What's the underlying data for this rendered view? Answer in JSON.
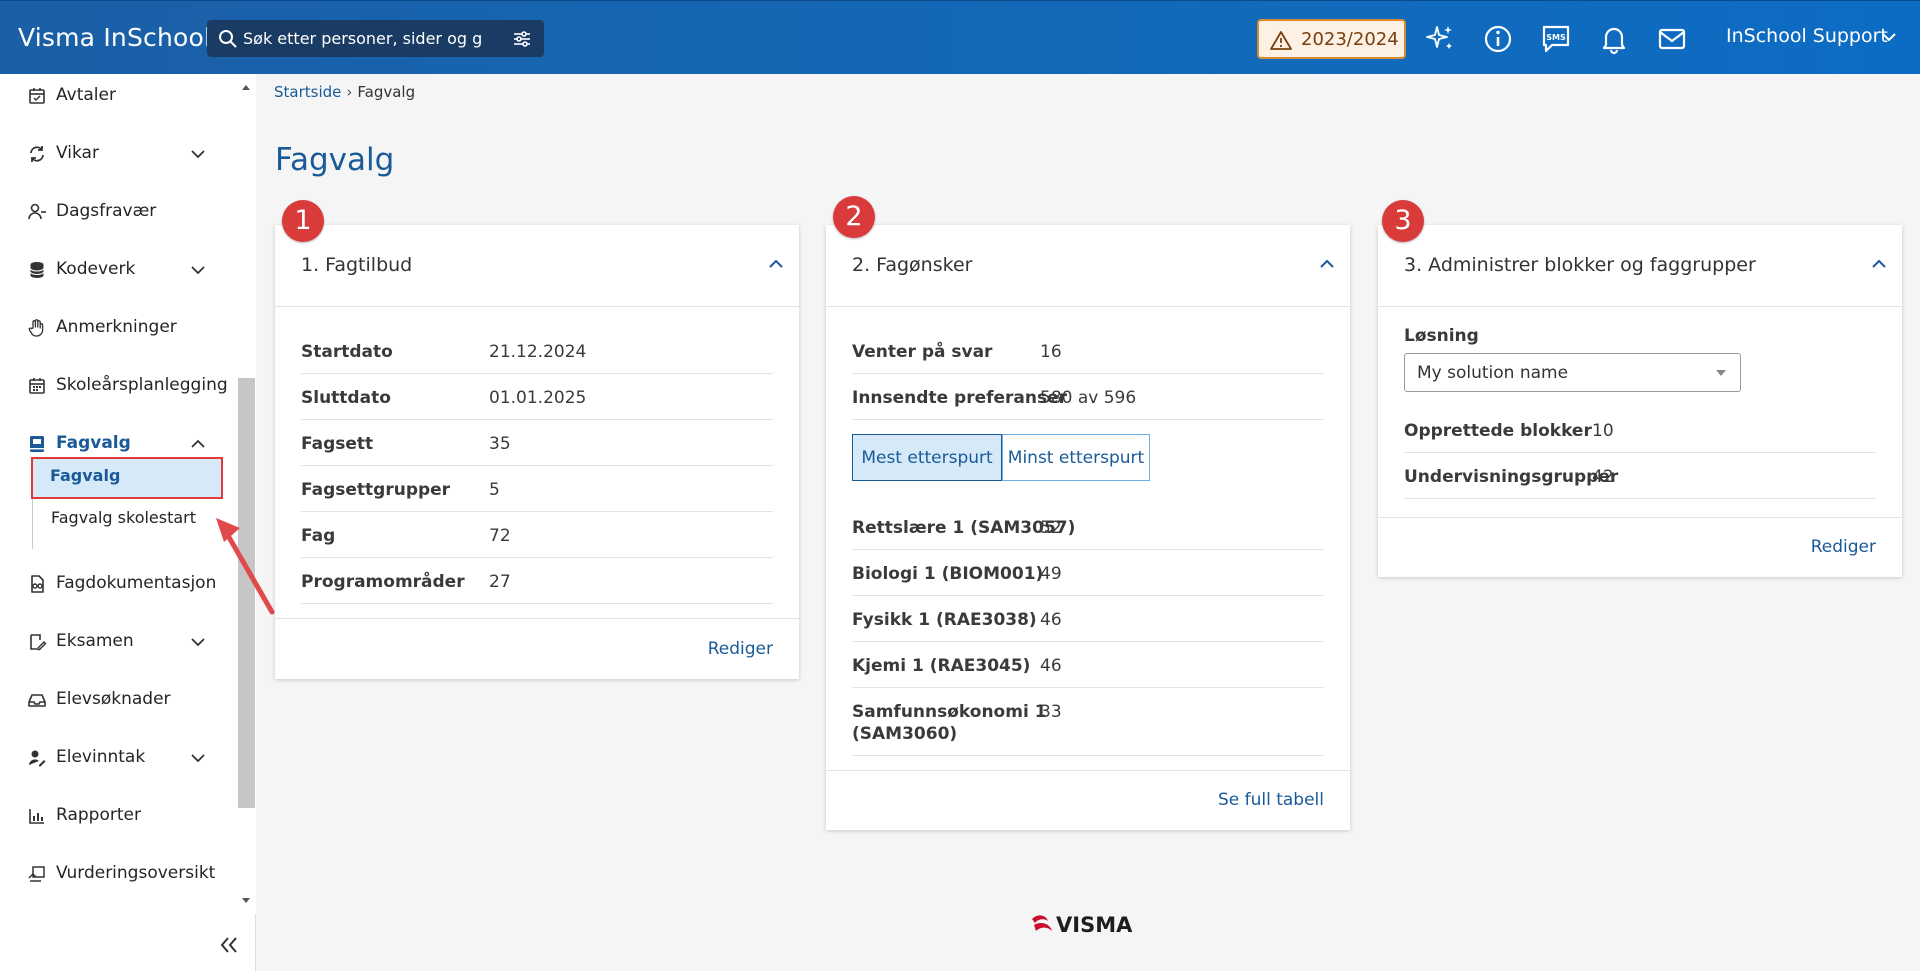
{
  "app": {
    "brand": "Visma InSchool",
    "search_placeholder": "Søk etter personer, sider og gru",
    "school_year": "2023/2024",
    "user_name": "InSchool Support"
  },
  "sidebar": {
    "items": [
      {
        "label": "Avtaler"
      },
      {
        "label": "Vikar"
      },
      {
        "label": "Dagsfravær"
      },
      {
        "label": "Kodeverk"
      },
      {
        "label": "Anmerkninger"
      },
      {
        "label": "Skoleårsplanlegging"
      },
      {
        "label": "Fagvalg"
      },
      {
        "label": "Fagdokumentasjon"
      },
      {
        "label": "Eksamen"
      },
      {
        "label": "Elevsøknader"
      },
      {
        "label": "Elevinntak"
      },
      {
        "label": "Rapporter"
      },
      {
        "label": "Vurderingsoversikt"
      }
    ],
    "sub_items": [
      {
        "label": "Fagvalg"
      },
      {
        "label": "Fagvalg skolestart"
      }
    ]
  },
  "breadcrumb": {
    "home": "Startside",
    "current": "Fagvalg"
  },
  "page": {
    "title": "Fagvalg"
  },
  "cards": {
    "fagtilbud": {
      "badge": "1",
      "title": "1. Fagtilbud",
      "rows": [
        {
          "key": "Startdato",
          "value": "21.12.2024"
        },
        {
          "key": "Sluttdato",
          "value": "01.01.2025"
        },
        {
          "key": "Fagsett",
          "value": "35"
        },
        {
          "key": "Fagsettgrupper",
          "value": "5"
        },
        {
          "key": "Fag",
          "value": "72"
        },
        {
          "key": "Programområder",
          "value": "27"
        }
      ],
      "action": "Rediger"
    },
    "fagonsker": {
      "badge": "2",
      "title": "2. Fagønsker",
      "rows": [
        {
          "key": "Venter på svar",
          "value": "16"
        },
        {
          "key": "Innsendte preferanser",
          "value": "580 av 596"
        }
      ],
      "toggle": {
        "a": "Mest etterspurt",
        "b": "Minst etterspurt"
      },
      "subjects": [
        {
          "key": "Rettslære 1 (SAM3057)",
          "value": "52"
        },
        {
          "key": "Biologi 1 (BIOM001)",
          "value": "49"
        },
        {
          "key": "Fysikk 1 (RAE3038)",
          "value": "46"
        },
        {
          "key": "Kjemi 1 (RAE3045)",
          "value": "46"
        },
        {
          "key_line1": "Samfunnsøkonomi 1",
          "key_line2": "(SAM3060)",
          "value": "33"
        }
      ],
      "action": "Se full tabell"
    },
    "blokker": {
      "badge": "3",
      "title": "3. Administrer blokker og faggrupper",
      "solution_label": "Løsning",
      "solution_value": "My solution name",
      "rows": [
        {
          "key": "Opprettede blokker",
          "value": "10"
        },
        {
          "key": "Undervisningsgrupper",
          "value": "42"
        }
      ],
      "action": "Rediger"
    }
  },
  "footer": {
    "logo_text": "VISMA"
  },
  "colors": {
    "primary": "#1a5a99",
    "topbar": "#1369b9",
    "badge": "#d93a3a",
    "warning": "#d98b2e"
  }
}
